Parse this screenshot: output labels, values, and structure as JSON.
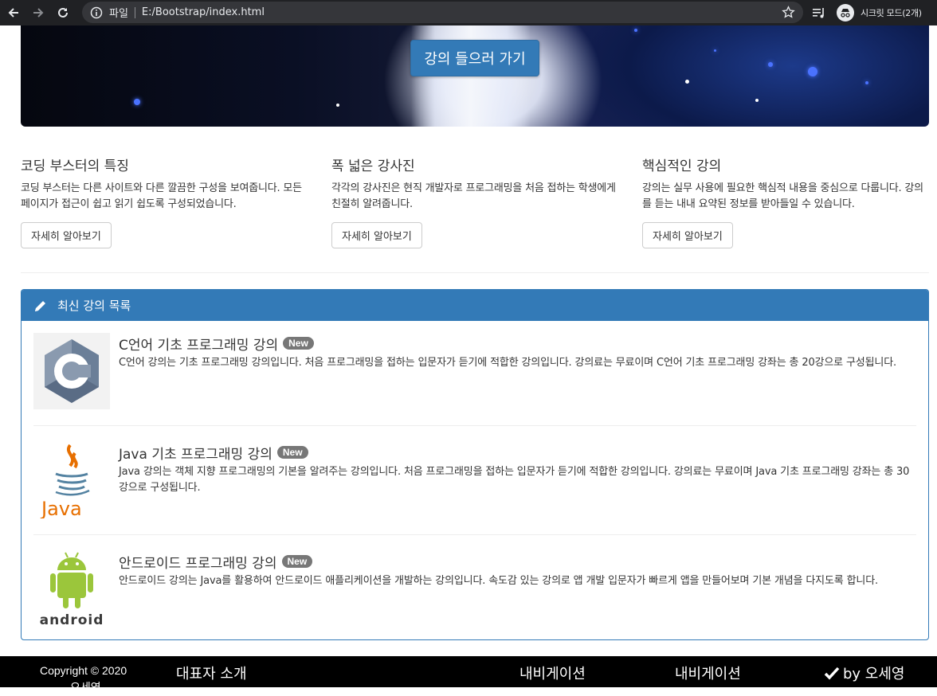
{
  "browser": {
    "scheme_label": "파일",
    "url": "E:/Bootstrap/index.html",
    "incognito_label": "시크릿 모드(2개)"
  },
  "hero": {
    "button_label": "강의 들으러 가기"
  },
  "features": [
    {
      "title": "코딩 부스터의 특징",
      "text": "코딩 부스터는 다른 사이트와 다른 깔끔한 구성을 보여줍니다. 모든 페이지가 접근이 쉽고 읽기 쉽도록 구성되었습니다.",
      "button_label": "자세히 알아보기"
    },
    {
      "title": "폭 넓은 강사진",
      "text": "각각의 강사진은 현직 개발자로 프로그래밍을 처음 접하는 학생에게 친절히 알려줍니다.",
      "button_label": "자세히 알아보기"
    },
    {
      "title": "핵심적인 강의",
      "text": "강의는 실무 사용에 필요한 핵심적 내용을 중심으로 다룹니다. 강의를 듣는 내내 요약된 정보를 받아들일 수 있습니다.",
      "button_label": "자세히 알아보기"
    }
  ],
  "panel": {
    "title": "최신 강의 목록",
    "items": [
      {
        "heading": "C언어 기초 프로그래밍 강의",
        "badge": "New",
        "text": "C언어 강의는 기초 프로그래밍 강의입니다. 처음 프로그래밍을 접하는 입문자가 듣기에 적합한 강의입니다. 강의료는 무료이며 C언어 기초 프로그래밍 강좌는 총 20강으로 구성됩니다.",
        "logo_letter": "C"
      },
      {
        "heading": "Java 기초 프로그래밍 강의",
        "badge": "New",
        "text": "Java 강의는 객체 지향 프로그래밍의 기본을 알려주는 강의입니다. 처음 프로그래밍을 접하는 입문자가 듣기에 적합한 강의입니다. 강의료는 무료이며 Java 기초 프로그래밍 강좌는 총 30강으로 구성됩니다.",
        "logo_text": "Java"
      },
      {
        "heading": "안드로이드 프로그래밍 강의",
        "badge": "New",
        "text": "안드로이드 강의는 Java를 활용하여 안드로이드 애플리케이션을 개발하는 강의입니다. 속도감 있는 강의로 앱 개발 입문자가 빠르게 앱을 만들어보며 기본 개념을 다지도록 합니다.",
        "logo_text": "android"
      }
    ]
  },
  "footer": {
    "copyright": "Copyright © 2020",
    "copyright_name": "오세영",
    "col1": "대표자 소개",
    "col2": "내비게이션",
    "col3": "내비게이션",
    "by": "by 오세영"
  }
}
